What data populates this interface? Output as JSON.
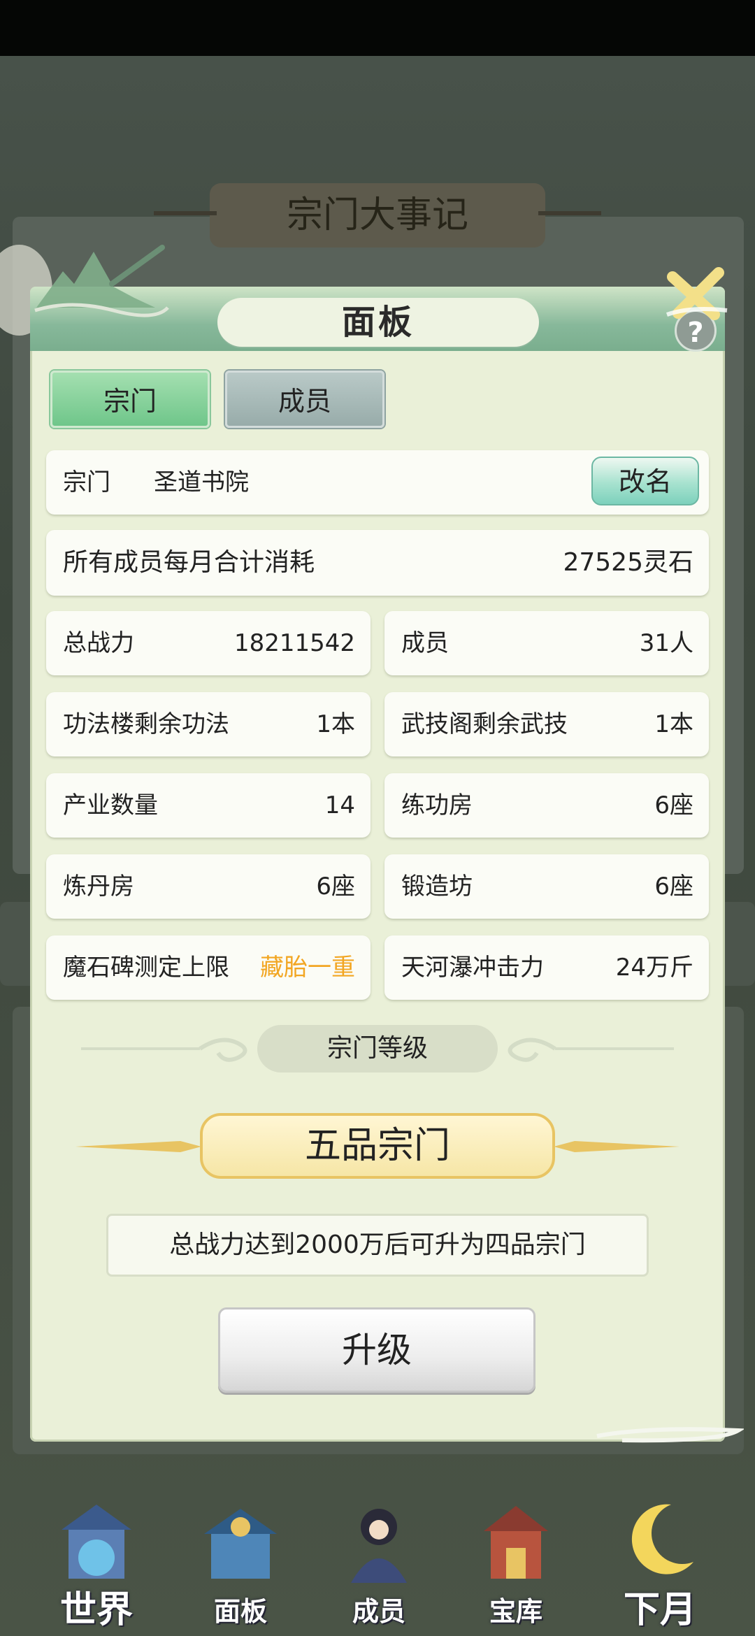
{
  "background": {
    "title": "宗门大事记"
  },
  "panel": {
    "title": "面板",
    "help_label": "?",
    "tabs": [
      {
        "label": "宗门",
        "active": true
      },
      {
        "label": "成员",
        "active": false
      }
    ],
    "sect_label": "宗门",
    "sect_name": "圣道书院",
    "rename_label": "改名",
    "consumption": {
      "label": "所有成员每月合计消耗",
      "value": "27525灵石"
    },
    "stats": [
      {
        "label": "总战力",
        "value": "18211542"
      },
      {
        "label": "成员",
        "value": "31人"
      },
      {
        "label": "功法楼剩余功法",
        "value": "1本"
      },
      {
        "label": "武技阁剩余武技",
        "value": "1本"
      },
      {
        "label": "产业数量",
        "value": "14"
      },
      {
        "label": "练功房",
        "value": "6座"
      },
      {
        "label": "炼丹房",
        "value": "6座"
      },
      {
        "label": "锻造坊",
        "value": "6座"
      },
      {
        "label": "魔石碑测定上限",
        "value": "藏胎一重",
        "highlight": true
      },
      {
        "label": "天河瀑冲击力",
        "value": "24万斤"
      }
    ],
    "level_caption": "宗门等级",
    "rank": "五品宗门",
    "upgrade_note": "总战力达到2000万后可升为四品宗门",
    "upgrade_button": "升级"
  },
  "colors": {
    "highlight": "#f2a623",
    "panel_bg": "#eaf0d8",
    "header_green": "#7aae8e"
  },
  "bottom_nav": [
    {
      "label": "世界",
      "icon": "world-icon"
    },
    {
      "label": "面板",
      "icon": "panel-icon"
    },
    {
      "label": "成员",
      "icon": "member-icon"
    },
    {
      "label": "宝库",
      "icon": "treasury-icon"
    },
    {
      "label": "下月",
      "icon": "next-month-icon"
    }
  ]
}
